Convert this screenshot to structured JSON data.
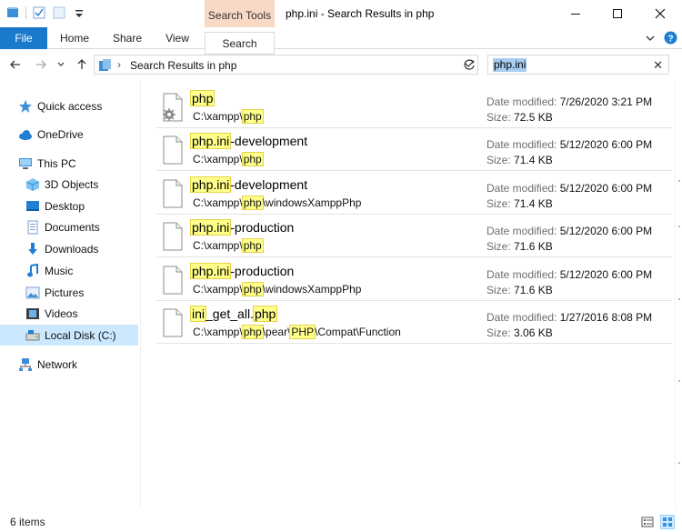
{
  "window": {
    "title": "php.ini - Search Results in php",
    "context_tab": "Search Tools"
  },
  "ribbon": {
    "tabs": [
      "File",
      "Home",
      "Share",
      "View",
      "Search"
    ]
  },
  "address": {
    "breadcrumb_sep": "›",
    "location": "Search Results in php"
  },
  "search": {
    "value": "php.ini",
    "clear_glyph": "✕"
  },
  "sidebar": {
    "items": [
      {
        "label": "Quick access",
        "icon": "star-icon"
      },
      {
        "label": "OneDrive",
        "icon": "cloud-icon"
      },
      {
        "label": "This PC",
        "icon": "computer-icon"
      },
      {
        "label": "3D Objects",
        "icon": "cube-icon"
      },
      {
        "label": "Desktop",
        "icon": "desktop-icon"
      },
      {
        "label": "Documents",
        "icon": "documents-icon"
      },
      {
        "label": "Downloads",
        "icon": "download-arrow-icon"
      },
      {
        "label": "Music",
        "icon": "music-note-icon"
      },
      {
        "label": "Pictures",
        "icon": "pictures-icon"
      },
      {
        "label": "Videos",
        "icon": "film-icon"
      },
      {
        "label": "Local Disk (C:)",
        "icon": "drive-icon",
        "selected": true
      },
      {
        "label": "Network",
        "icon": "network-icon"
      }
    ]
  },
  "results": {
    "date_label": "Date modified:",
    "size_label": "Size:",
    "items": [
      {
        "name": [
          {
            "t": "php",
            "h": true
          }
        ],
        "path": [
          {
            "t": "C:\\xampp\\"
          },
          {
            "t": "php",
            "h": true
          }
        ],
        "date": "7/26/2020 3:21 PM",
        "size": "72.5 KB",
        "icon": "gear-file-icon"
      },
      {
        "name": [
          {
            "t": "php.ini",
            "h": true
          },
          {
            "t": "-development"
          }
        ],
        "path": [
          {
            "t": "C:\\xampp\\"
          },
          {
            "t": "php",
            "h": true
          }
        ],
        "date": "5/12/2020 6:00 PM",
        "size": "71.4 KB",
        "icon": "file-icon"
      },
      {
        "name": [
          {
            "t": "php.ini",
            "h": true
          },
          {
            "t": "-development"
          }
        ],
        "path": [
          {
            "t": "C:\\xampp\\"
          },
          {
            "t": "php",
            "h": true
          },
          {
            "t": "\\windowsXamppPhp"
          }
        ],
        "date": "5/12/2020 6:00 PM",
        "size": "71.4 KB",
        "icon": "file-icon"
      },
      {
        "name": [
          {
            "t": "php.ini",
            "h": true
          },
          {
            "t": "-production"
          }
        ],
        "path": [
          {
            "t": "C:\\xampp\\"
          },
          {
            "t": "php",
            "h": true
          }
        ],
        "date": "5/12/2020 6:00 PM",
        "size": "71.6 KB",
        "icon": "file-icon"
      },
      {
        "name": [
          {
            "t": "php.ini",
            "h": true
          },
          {
            "t": "-production"
          }
        ],
        "path": [
          {
            "t": "C:\\xampp\\"
          },
          {
            "t": "php",
            "h": true
          },
          {
            "t": "\\windowsXamppPhp"
          }
        ],
        "date": "5/12/2020 6:00 PM",
        "size": "71.6 KB",
        "icon": "file-icon"
      },
      {
        "name": [
          {
            "t": "ini",
            "h": true
          },
          {
            "t": "_get_all."
          },
          {
            "t": "php",
            "h": true
          }
        ],
        "path": [
          {
            "t": "C:\\xampp\\"
          },
          {
            "t": "php",
            "h": true
          },
          {
            "t": "\\pear\\"
          },
          {
            "t": "PHP",
            "h": true
          },
          {
            "t": "\\Compat\\Function"
          }
        ],
        "date": "1/27/2016 8:08 PM",
        "size": "3.06 KB",
        "icon": "file-icon"
      }
    ]
  },
  "status": {
    "count": "6 items"
  },
  "colors": {
    "accent": "#1979ca",
    "context_tab": "#f9d9c5",
    "highlight": "#ffff8a",
    "selected_nav": "#cce8ff"
  }
}
